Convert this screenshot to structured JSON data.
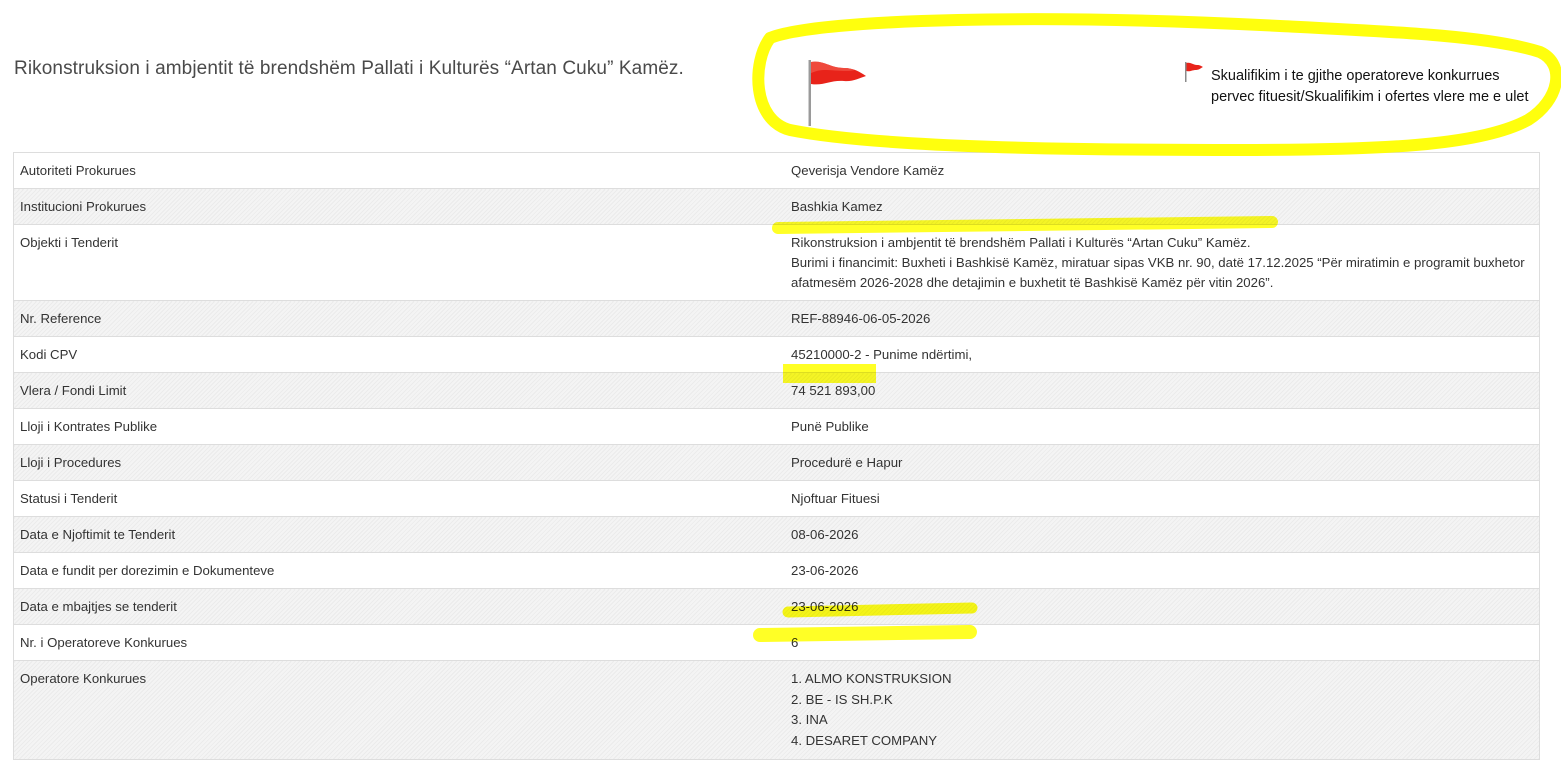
{
  "page": {
    "title": "Rikonstruksion i ambjentit të brendshëm Pallati i Kulturës “Artan Cuku” Kamëz."
  },
  "flags": {
    "big_flag_icon": "red-flag-icon",
    "small_flag_icon": "red-flag-icon",
    "note": "Skualifikim i te gjithe operatoreve konkurrues pervec fituesit/Skualifikim i ofertes vlere me e ulet"
  },
  "colors": {
    "highlight": "#ffff00",
    "flag_red": "#e8231a",
    "border": "#dddddd",
    "row_shade": "#f4f4f4"
  },
  "details": {
    "autoriteti": {
      "label": "Autoriteti Prokurues",
      "value": "Qeverisja Vendore Kamëz"
    },
    "institucioni": {
      "label": "Institucioni Prokurues",
      "value": "Bashkia Kamez"
    },
    "objekti": {
      "label": "Objekti i Tenderit",
      "value_line1": "Rikonstruksion i ambjentit të brendshëm Pallati i Kulturës “Artan Cuku” Kamëz.",
      "value_line2": "Burimi i financimit: Buxheti i Bashkisë Kamëz, miratuar sipas VKB nr. 90, datë 17.12.2025 “Për miratimin e programit buxhetor afatmesëm 2026-2028 dhe detajimin e buxhetit të Bashkisë Kamëz për vitin 2026”."
    },
    "reference": {
      "label": "Nr. Reference",
      "value": "REF-88946-06-05-2026"
    },
    "cpv": {
      "label": "Kodi CPV",
      "value": "45210000-2 - Punime ndërtimi,"
    },
    "vlera": {
      "label": "Vlera / Fondi Limit",
      "value": "74 521 893,00"
    },
    "kontrata": {
      "label": "Lloji i Kontrates Publike",
      "value": "Punë Publike"
    },
    "procedura": {
      "label": "Lloji i Procedures",
      "value": "Procedurë e Hapur"
    },
    "statusi": {
      "label": "Statusi i Tenderit",
      "value": "Njoftuar Fituesi"
    },
    "data_njoftimit": {
      "label": "Data e Njoftimit te Tenderit",
      "value": "08-06-2026"
    },
    "data_dorezimit": {
      "label": "Data e fundit per dorezimin e Dokumenteve",
      "value": "23-06-2026"
    },
    "data_mbajtjes": {
      "label": "Data e mbajtjes se tenderit",
      "value": "23-06-2026"
    },
    "nr_operatoreve": {
      "label": "Nr. i Operatoreve Konkurues",
      "value": "6"
    },
    "operatoret": {
      "label": "Operatore Konkurues",
      "items": [
        "1. ALMO KONSTRUKSION",
        "2. BE - IS SH.P.K",
        "3. INA",
        "4. DESARET COMPANY"
      ]
    }
  }
}
